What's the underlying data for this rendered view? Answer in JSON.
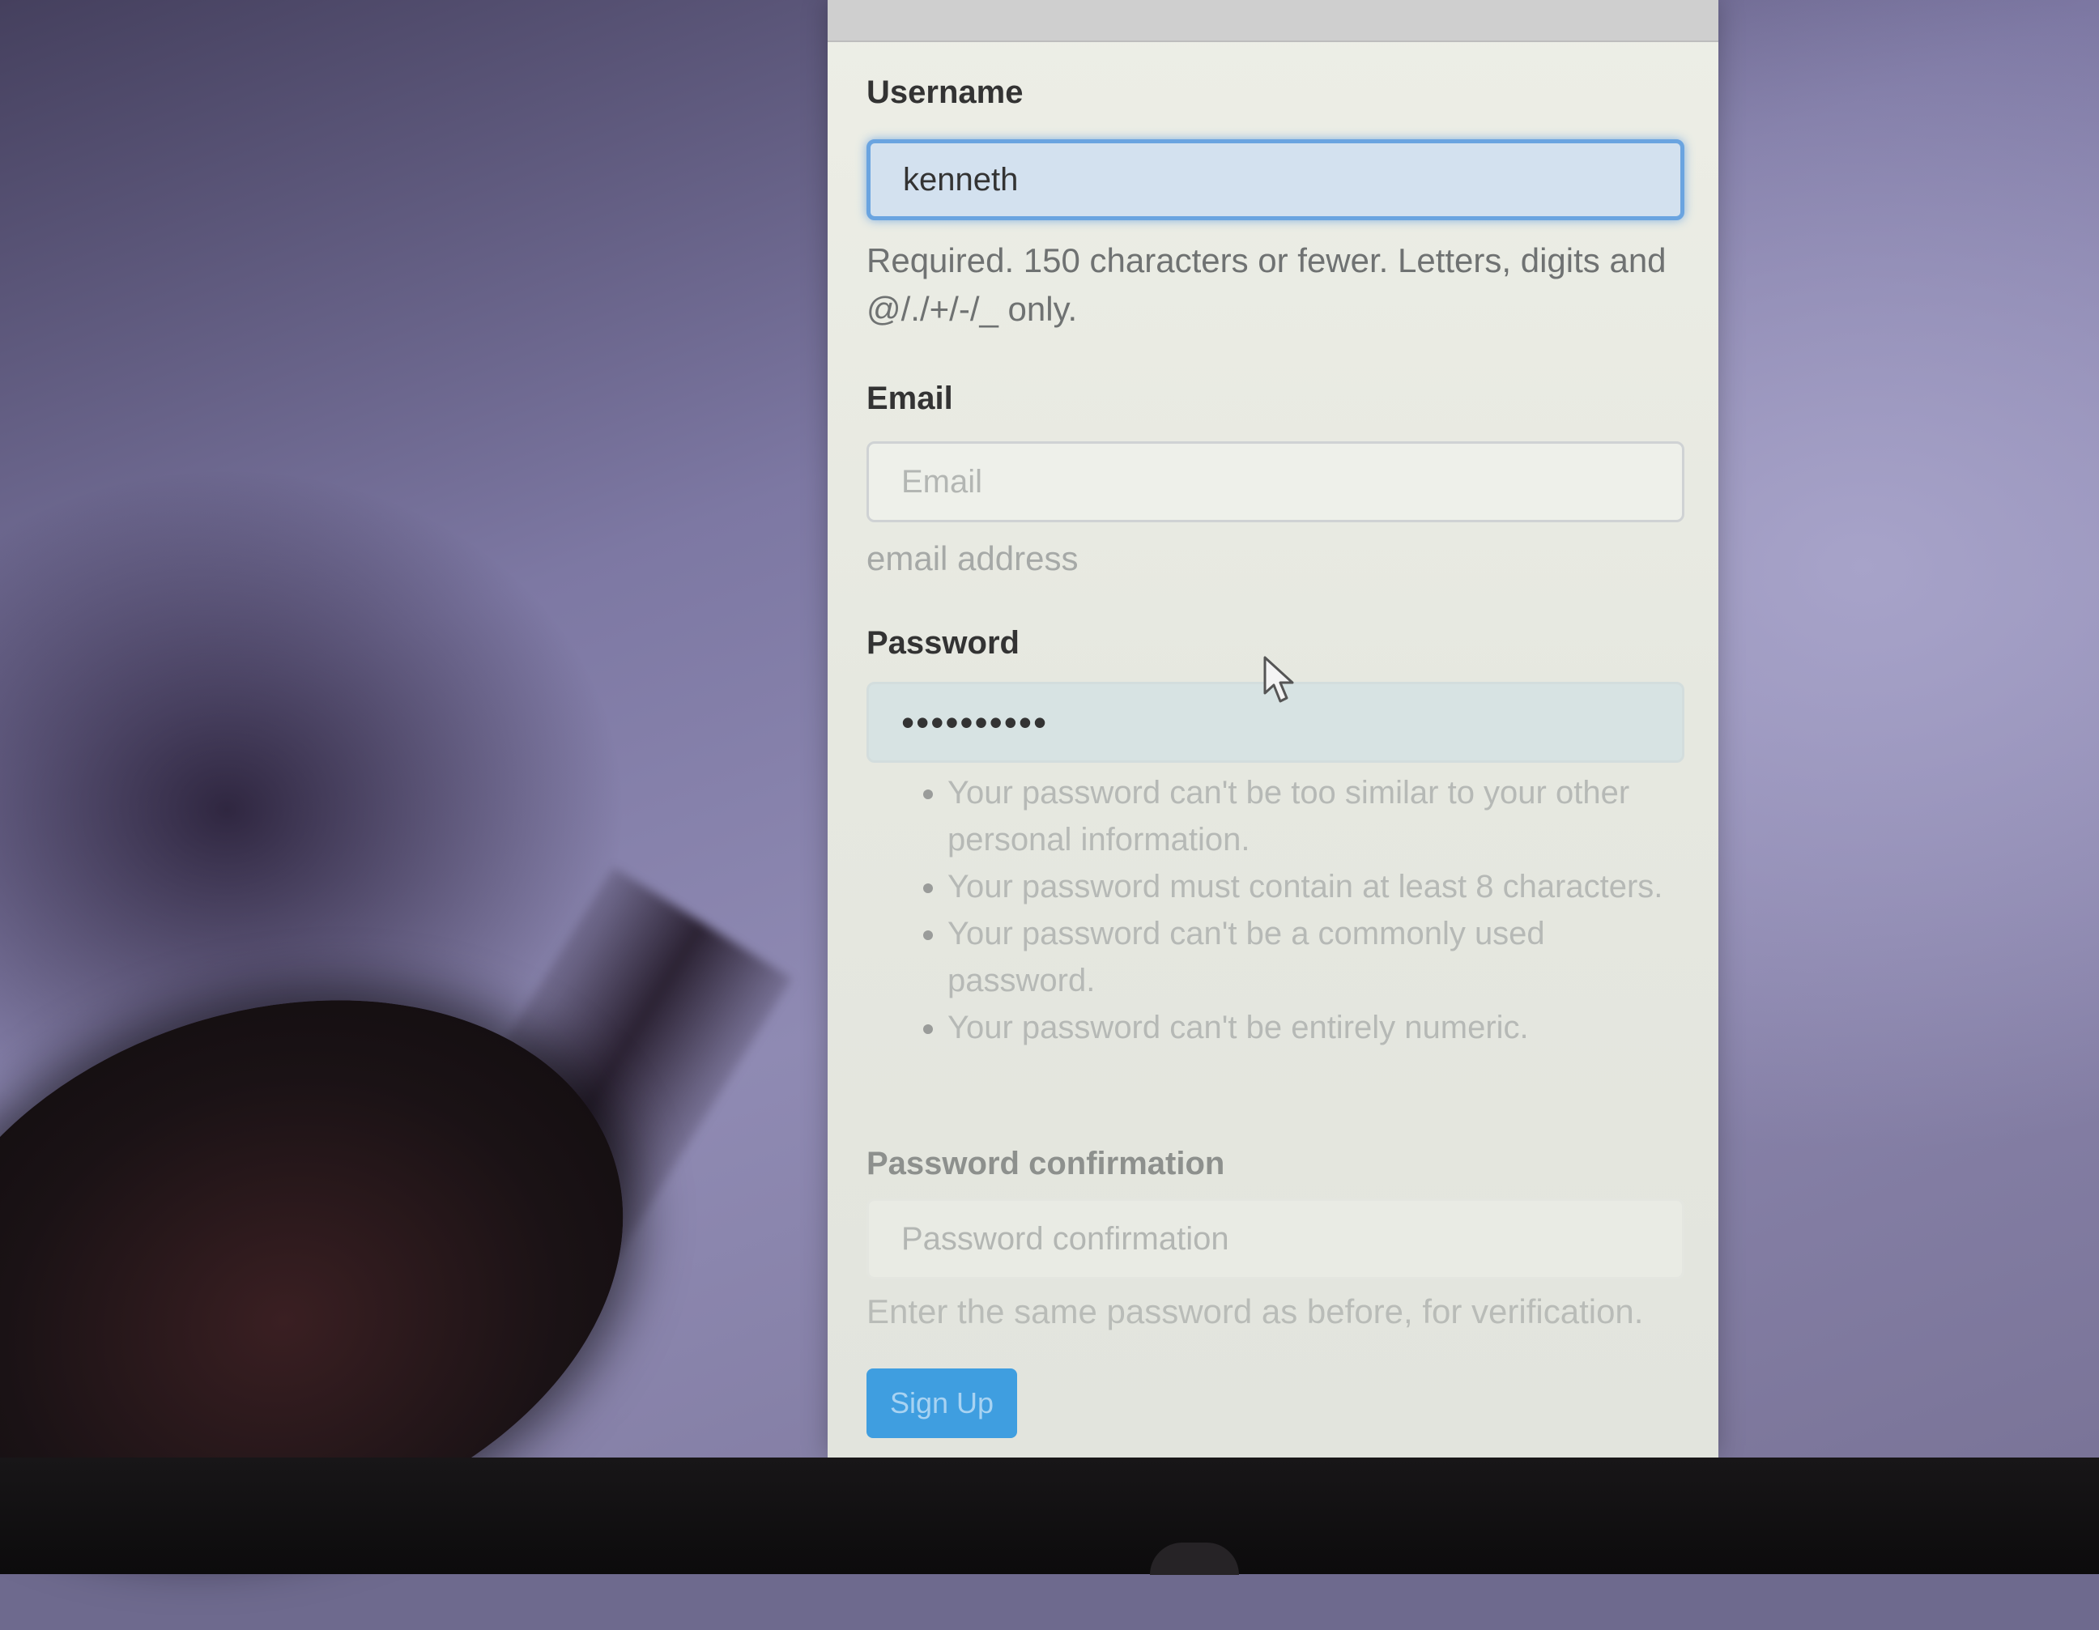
{
  "form": {
    "username": {
      "label": "Username",
      "value": "kenneth",
      "help": "Required. 150 characters or fewer. Letters, digits and @/./+/-/_ only."
    },
    "email": {
      "label": "Email",
      "placeholder": "Email",
      "help": "email address"
    },
    "password": {
      "label": "Password",
      "value": "••••••••••",
      "rules": [
        "Your password can't be too similar to your other personal information.",
        "Your password must contain at least 8 characters.",
        "Your password can't be a commonly used password.",
        "Your password can't be entirely numeric."
      ]
    },
    "password_confirmation": {
      "label": "Password confirmation",
      "placeholder": "Password confirmation",
      "help": "Enter the same password as before, for verification."
    },
    "submit_label": "Sign Up"
  },
  "colors": {
    "accent": "#3f9ee0",
    "focus_border": "#6aa4e0",
    "card_background": "#edeee6"
  },
  "icons": {
    "cursor": "mouse-pointer-icon"
  }
}
